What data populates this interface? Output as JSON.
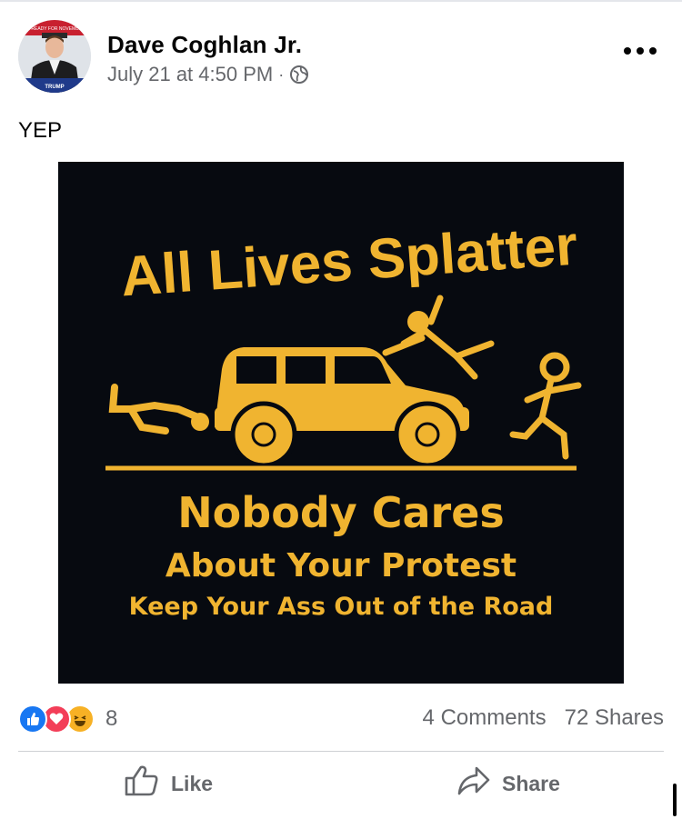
{
  "post": {
    "author": "Dave Coghlan Jr.",
    "timestamp": "July 21 at 4:50 PM",
    "separator": "·",
    "privacy_icon": "globe-icon",
    "text": "YEP"
  },
  "avatar": {
    "banner_top": "I'M READY FOR NOVEMBER",
    "banner_bottom": "TRUMP"
  },
  "image": {
    "headline": "All Lives Splatter",
    "line1": "Nobody Cares",
    "line2": "About Your Protest",
    "line3": "Keep Your Ass Out of the Road",
    "text_color": "#f0b430",
    "background": "#070a10"
  },
  "reactions": {
    "types": [
      "like",
      "love",
      "haha"
    ],
    "count": "8"
  },
  "stats": {
    "comments": "4 Comments",
    "shares": "72 Shares"
  },
  "actions": {
    "like": "Like",
    "share": "Share"
  },
  "colors": {
    "like_blue": "#1877f2",
    "love_red": "#f33e58",
    "haha_yellow": "#f7b125",
    "secondary_text": "#65676b"
  }
}
